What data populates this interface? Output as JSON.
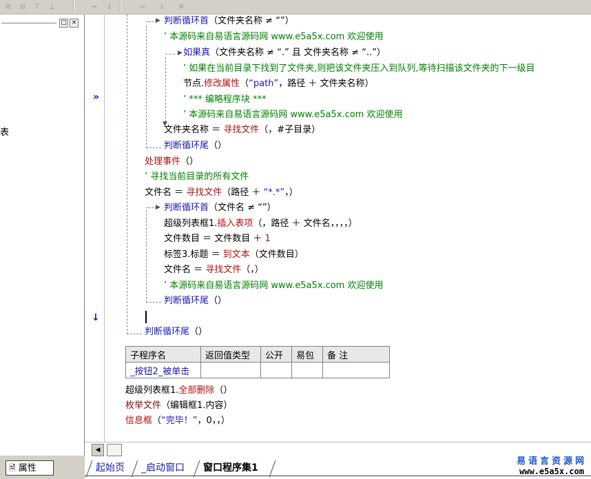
{
  "toolbar": {
    "icons": [
      "align-left-icon",
      "align-center-icon",
      "align-top-icon",
      "align-middle-icon",
      "same-width-icon",
      "same-height-icon",
      "h-spacing-icon",
      "v-spacing-icon",
      "center-icon"
    ]
  },
  "left_panel": {
    "min_label": "□",
    "close_label": "×",
    "clipped_text": "表"
  },
  "property_tab": {
    "label": "属性"
  },
  "gutter": {
    "bookmark_glyph": "»",
    "cursor_glyph": "↓"
  },
  "code": {
    "l1_kw": "判断循环首",
    "l1_rest": "（文件夹名称 ≠ “”）",
    "l2": "’ 本源码来自易语言源码网 www.e5a5x.com  欢迎使用",
    "l3_kw": "如果真",
    "l3_rest": "（文件夹名称 ≠ “.” 且 文件夹名称 ≠ “..”）",
    "l4": "’ 如果在当前目录下找到了文件夹,则把该文件夹压入到队列,等待扫描该文件夹的下一级目",
    "l5_a": "节点.",
    "l5_fn": "修改属性",
    "l5_b": "（",
    "l5_str": "“path”",
    "l5_c": "，路径 ＋ 文件夹名称）",
    "l6": "’ *** 编略程序块 ***",
    "l7": "’ 本源码来自易语言源码网 www.e5a5x.com  欢迎使用",
    "l8_a": "文件夹名称 ＝ ",
    "l8_fn": "寻找文件",
    "l8_b": "（，#子目录）",
    "l9_kw": "判断循环尾",
    "l9_rest": "（）",
    "l10_fn": "处理事件",
    "l10_rest": "（）",
    "l11": "’ 寻找当前目录的所有文件",
    "l12_a": "文件名 ＝ ",
    "l12_fn": "寻找文件",
    "l12_b": "（路径 ＋ ",
    "l12_str": "“*.*”",
    "l12_c": "，）",
    "l13_kw": "判断循环首",
    "l13_rest": "（文件名 ≠ “”）",
    "l14_a": "超级列表框1.",
    "l14_fn": "插入表项",
    "l14_b": "（，路径 ＋ 文件名，，，，）",
    "l15_a": "文件数目 ＝ 文件数目 ＋ ",
    "l15_num": "1",
    "l16_a": "标签3.标题 ＝ ",
    "l16_fn": "到文本",
    "l16_b": "（文件数目）",
    "l17_a": "文件名 ＝ ",
    "l17_fn": "寻找文件",
    "l17_b": "（，）",
    "l18": "’ 本源码来自易语言源码网 www.e5a5x.com  欢迎使用",
    "l19_kw": "判断循环尾",
    "l19_rest": "（）",
    "l20_kw": "判断循环尾",
    "l20_rest": "（）"
  },
  "sub_table": {
    "headers": [
      "子程序名",
      "返回值类型",
      "公开",
      "易包",
      "备 注"
    ],
    "row": [
      "_按钮2_被单击",
      "",
      "",
      "",
      ""
    ]
  },
  "code2": {
    "m1_a": "超级列表框1.",
    "m1_fn": "全部删除",
    "m1_b": "（）",
    "m2_fn": "枚举文件",
    "m2_b": "（编辑框1.内容）",
    "m3_fn": "信息框",
    "m3_b": "（",
    "m3_str": "“完毕！”",
    "m3_c": "，0，，）"
  },
  "hscroll": {
    "left_glyph": "◀"
  },
  "tabs": [
    "起始页",
    "_启动窗口",
    "窗口程序集1"
  ],
  "brand": {
    "cn": "易语言资源网",
    "url": "www.e5a5x.com"
  },
  "colors": {
    "keyword": "#1a1ab0",
    "function": "#b01010",
    "comment": "#008000"
  }
}
